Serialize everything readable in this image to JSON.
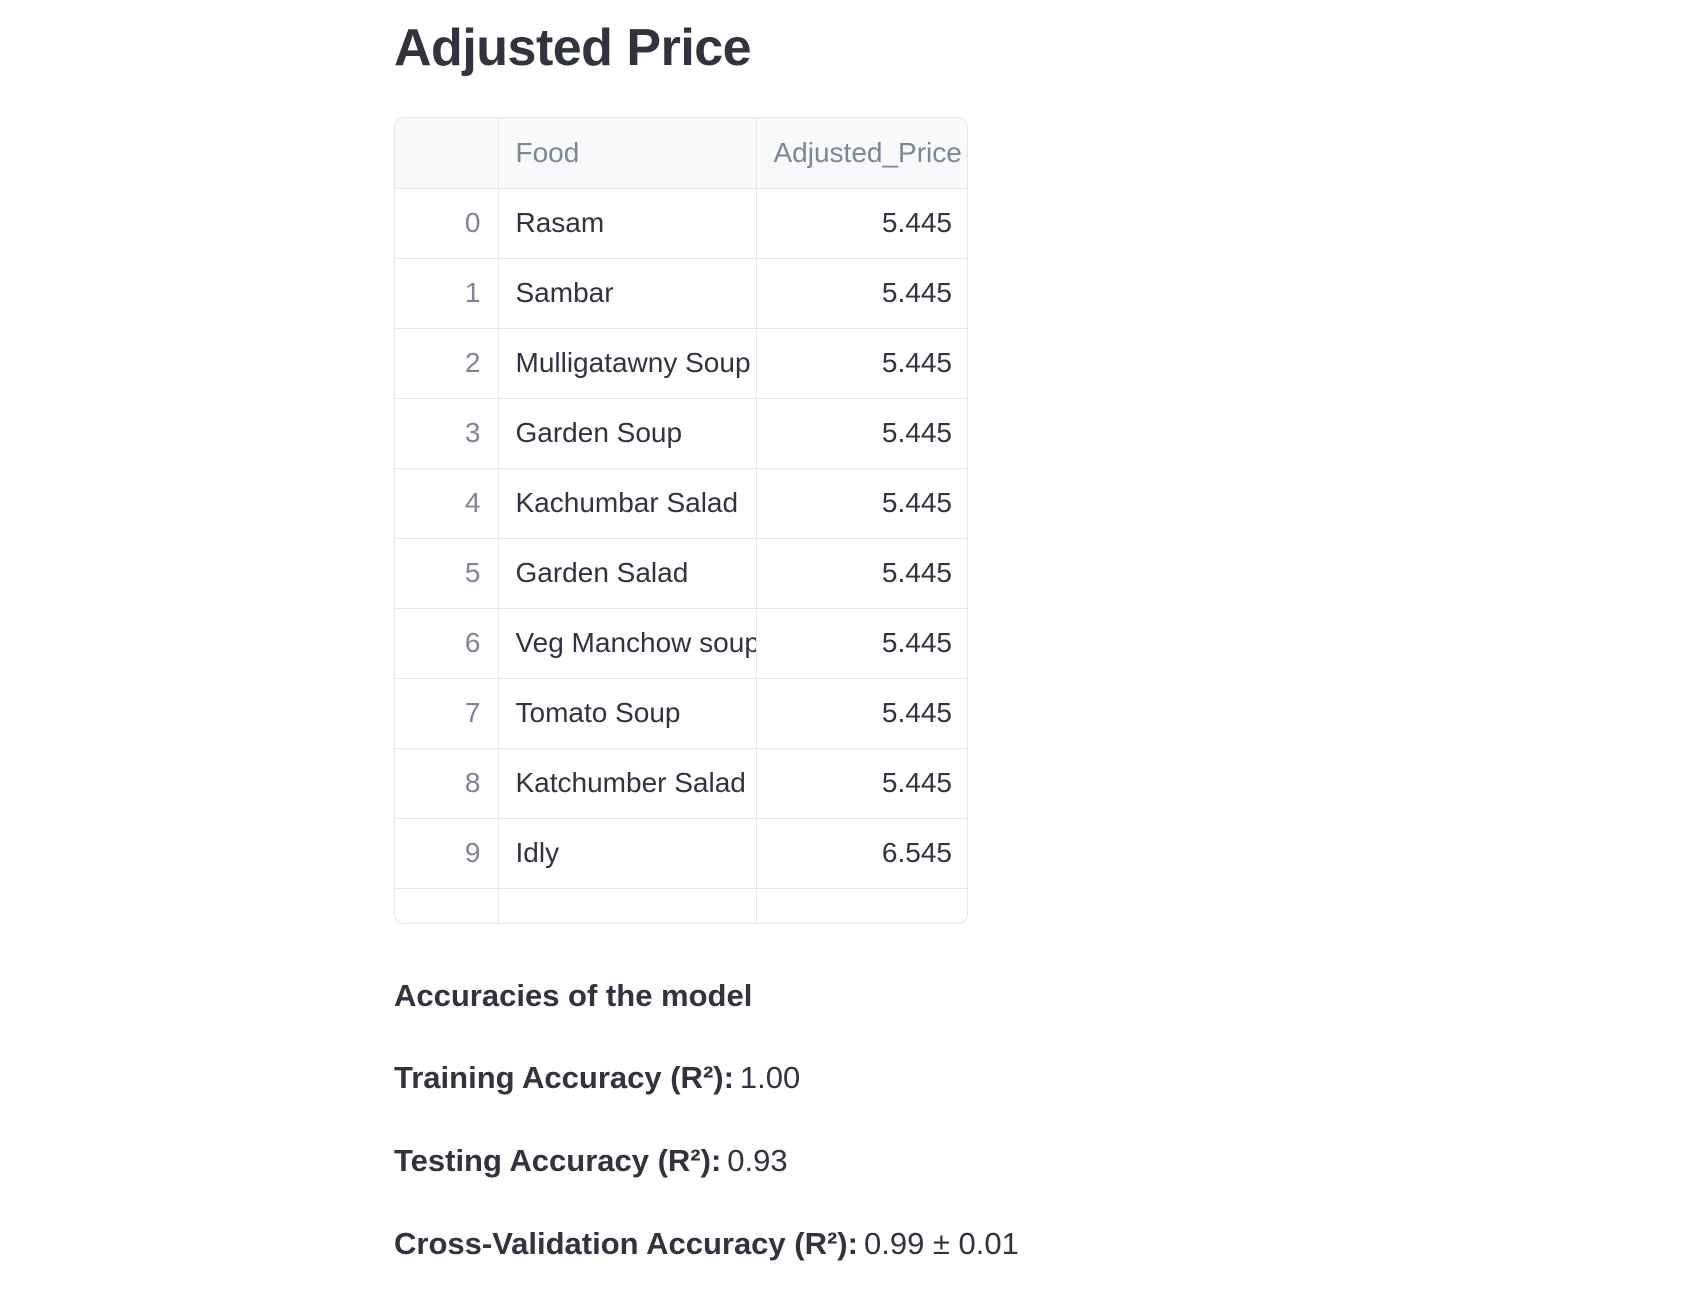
{
  "page": {
    "title": "Adjusted Price"
  },
  "table": {
    "columns": [
      "",
      "Food",
      "Adjusted_Price"
    ],
    "rows": [
      {
        "index": "0",
        "food": "Rasam",
        "price": "5.445"
      },
      {
        "index": "1",
        "food": "Sambar",
        "price": "5.445"
      },
      {
        "index": "2",
        "food": "Mulligatawny Soup",
        "price": "5.445"
      },
      {
        "index": "3",
        "food": "Garden Soup",
        "price": "5.445"
      },
      {
        "index": "4",
        "food": "Kachumbar Salad",
        "price": "5.445"
      },
      {
        "index": "5",
        "food": "Garden Salad",
        "price": "5.445"
      },
      {
        "index": "6",
        "food": "Veg Manchow soup",
        "price": "5.445"
      },
      {
        "index": "7",
        "food": "Tomato Soup",
        "price": "5.445"
      },
      {
        "index": "8",
        "food": "Katchumber Salad",
        "price": "5.445"
      },
      {
        "index": "9",
        "food": "Idly",
        "price": "6.545"
      }
    ]
  },
  "accuracy": {
    "heading": "Accuracies of the model",
    "training_label": "Training Accuracy (R²):",
    "training_value": "1.00",
    "testing_label": "Testing Accuracy (R²):",
    "testing_value": "0.93",
    "cv_label": "Cross-Validation Accuracy (R²):",
    "cv_value": "0.99 ± 0.01"
  }
}
